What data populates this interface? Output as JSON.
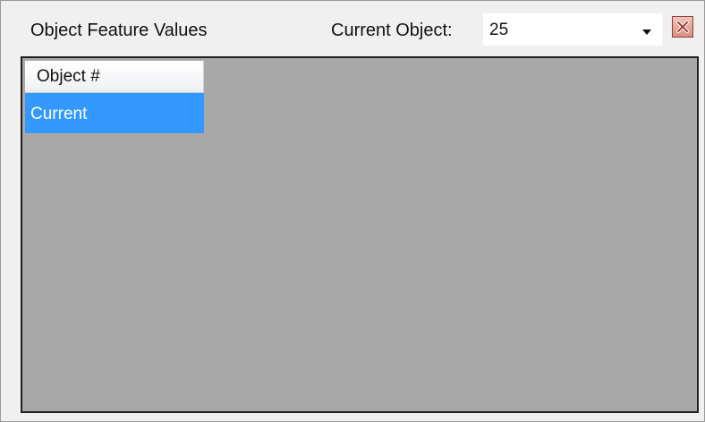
{
  "panel": {
    "title": "Object Feature Values",
    "current_object_label": "Current Object:",
    "current_object_value": "25"
  },
  "icons": {
    "dropdown": "chevron-down-icon",
    "close": "close-icon"
  },
  "colors": {
    "selected_row": "#3399ff",
    "grid_background": "#a8a8a8",
    "close_button": "#d98f81"
  },
  "grid": {
    "column_header": "Object #",
    "rows": [
      {
        "label": "Current",
        "selected": true
      }
    ]
  }
}
